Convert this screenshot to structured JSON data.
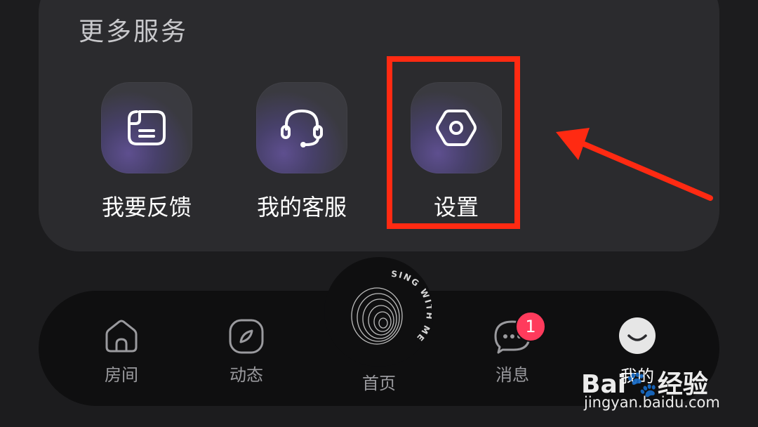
{
  "services": {
    "title": "更多服务",
    "items": [
      {
        "label": "我要反馈",
        "icon": "feedback-note-icon"
      },
      {
        "label": "我的客服",
        "icon": "headset-icon"
      },
      {
        "label": "设置",
        "icon": "hexagon-gear-icon"
      }
    ]
  },
  "highlight": {
    "color": "#ff2a12"
  },
  "nav": {
    "items": [
      {
        "label": "房间",
        "icon": "house-icon"
      },
      {
        "label": "动态",
        "icon": "compass-icon"
      },
      {
        "label": "首页",
        "icon": "sing-with-me-disc-icon"
      },
      {
        "label": "消息",
        "icon": "chat-bubble-icon"
      },
      {
        "label": "我的",
        "icon": "avatar-icon"
      }
    ],
    "center_disc_text": "SING WITH ME",
    "message_badge": "1"
  },
  "watermark": {
    "brand": "Bai",
    "brand_suffix": "经验",
    "url": "jingyan.baidu.com"
  }
}
